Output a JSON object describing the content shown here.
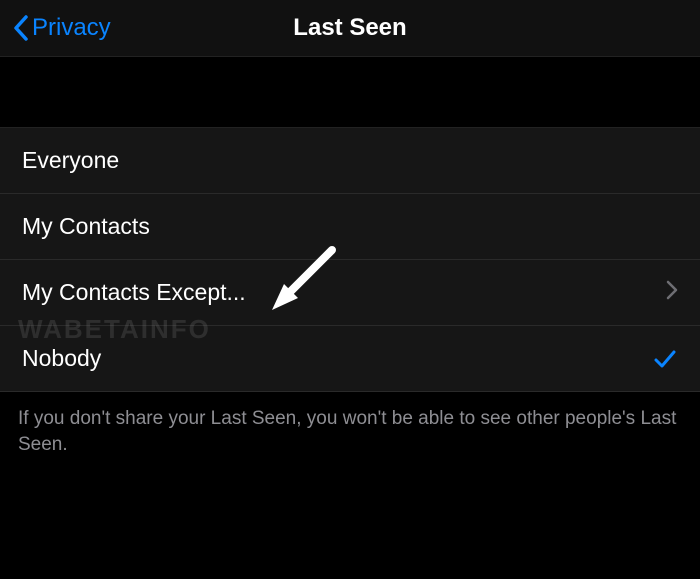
{
  "nav": {
    "back_label": "Privacy",
    "title": "Last Seen"
  },
  "options": {
    "everyone": "Everyone",
    "my_contacts": "My Contacts",
    "my_contacts_except": "My Contacts Except...",
    "nobody": "Nobody"
  },
  "selected": "nobody",
  "footer_text": "If you don't share your Last Seen, you won't be able to see other people's Last Seen.",
  "watermark": "WABETAINFO",
  "colors": {
    "accent": "#0a84ff",
    "bg": "#000000",
    "row_bg": "#161616",
    "secondary_text": "#8e8e93"
  }
}
